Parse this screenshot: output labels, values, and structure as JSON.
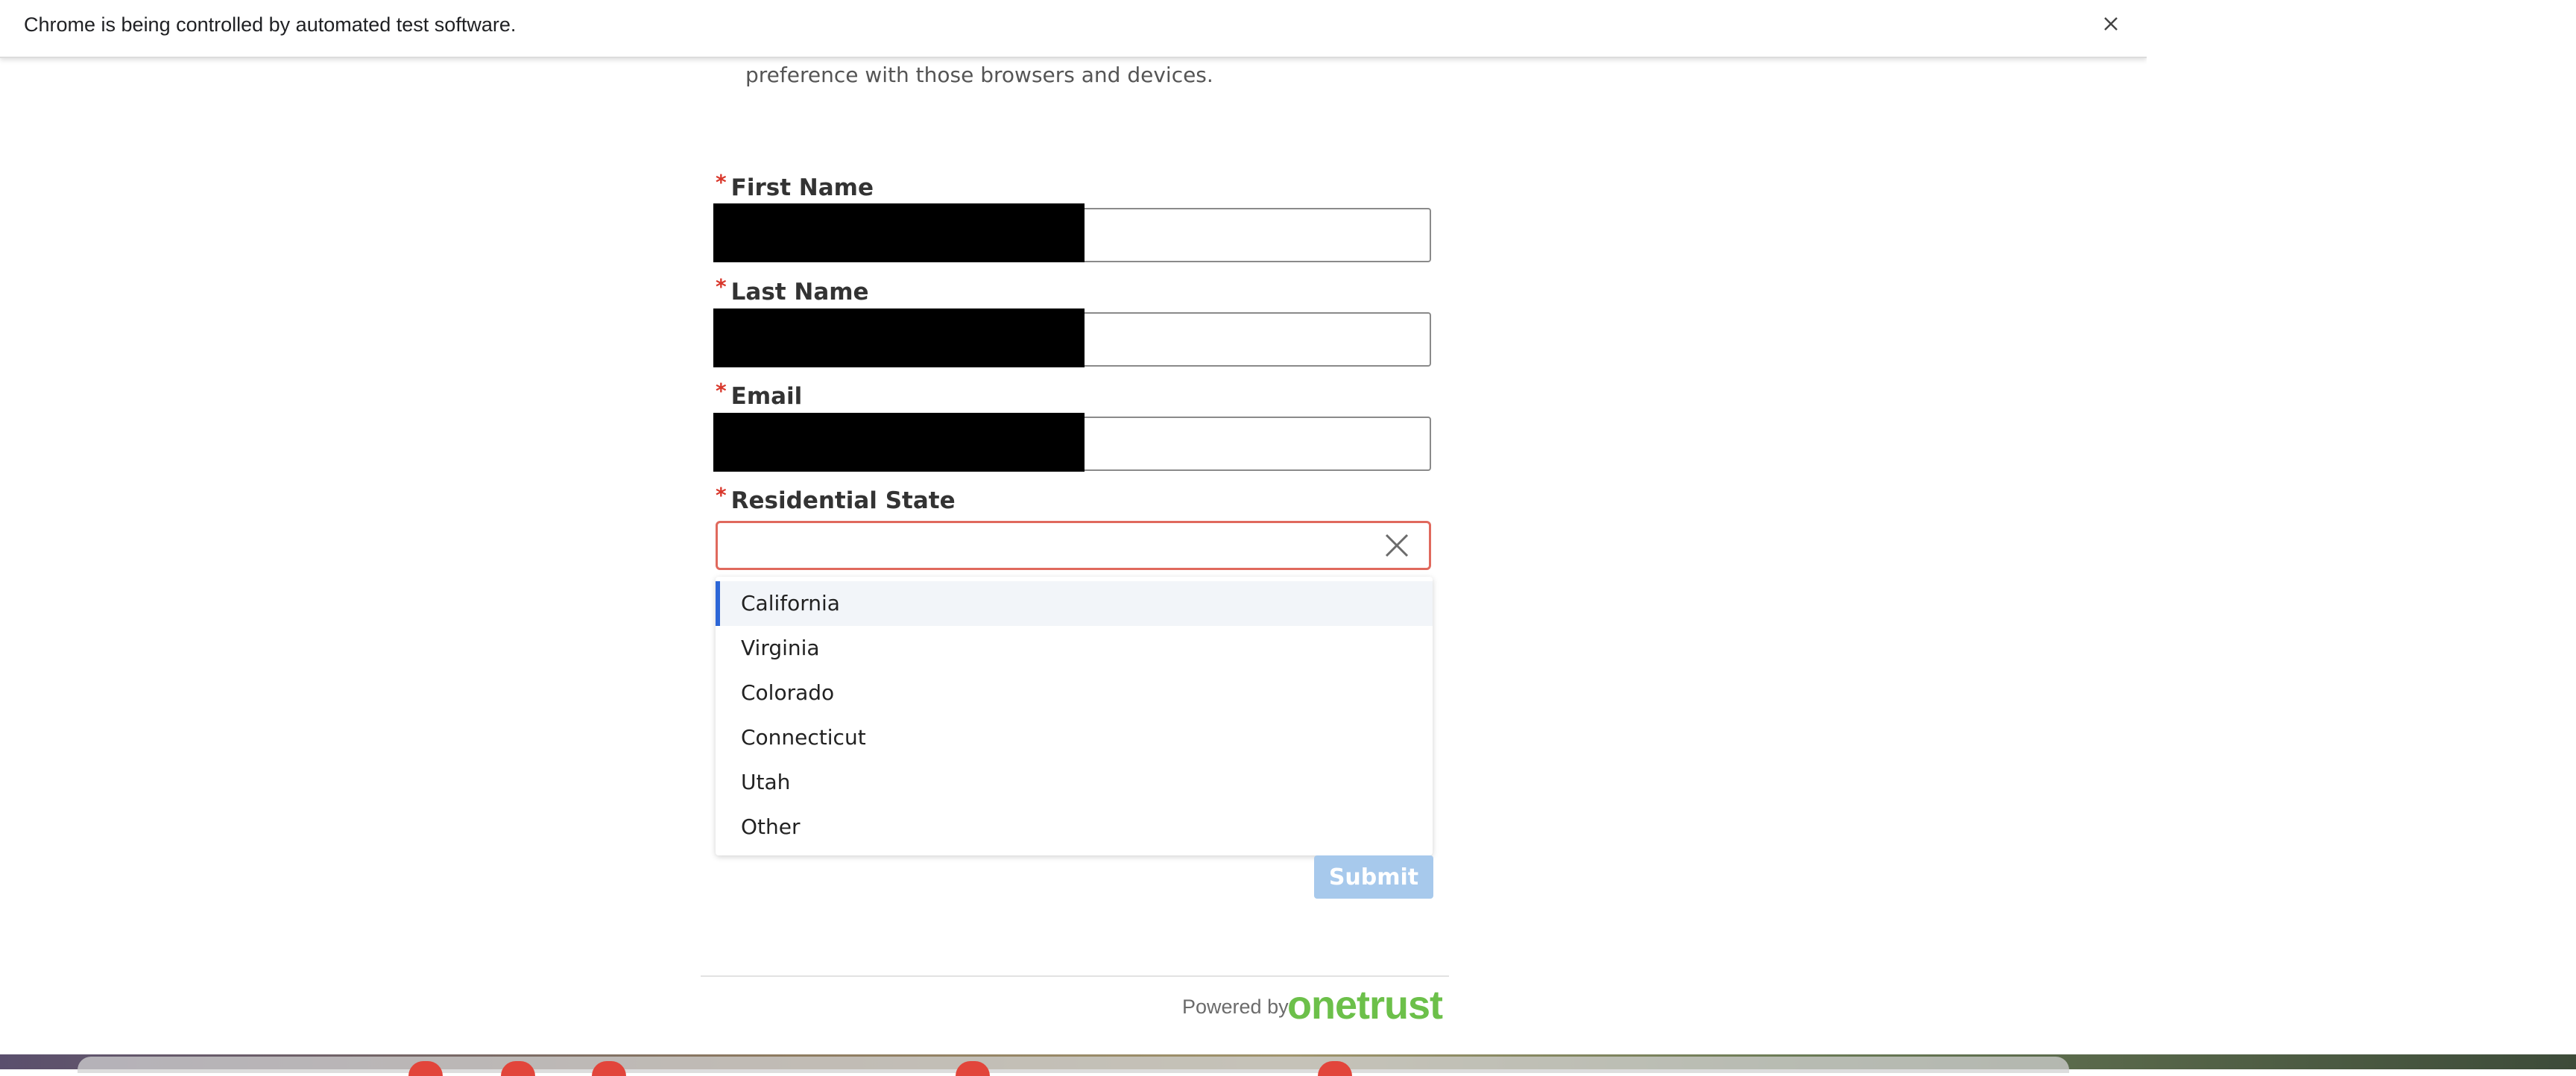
{
  "infobar": {
    "message": "Chrome is being controlled by automated test software."
  },
  "intro": {
    "clipped_line": "",
    "text": "preference with those browsers and devices."
  },
  "form": {
    "required_marker": "*",
    "first_name": {
      "label": "First Name",
      "value": ""
    },
    "last_name": {
      "label": "Last Name",
      "value": ""
    },
    "email": {
      "label": "Email",
      "value": ""
    },
    "residential_state": {
      "label": "Residential State",
      "value": "",
      "options": [
        "California",
        "Virginia",
        "Colorado",
        "Connecticut",
        "Utah",
        "Other"
      ],
      "highlighted_option": "California"
    },
    "submit_label": "Submit"
  },
  "footer": {
    "powered_by": "Powered by",
    "brand": "onetrust"
  },
  "colors": {
    "required": "#d9372b",
    "error_border": "#e0695d",
    "highlight_bar": "#2d66d6",
    "submit_disabled": "#a7c9ec",
    "brand_green": "#6cc04a"
  }
}
